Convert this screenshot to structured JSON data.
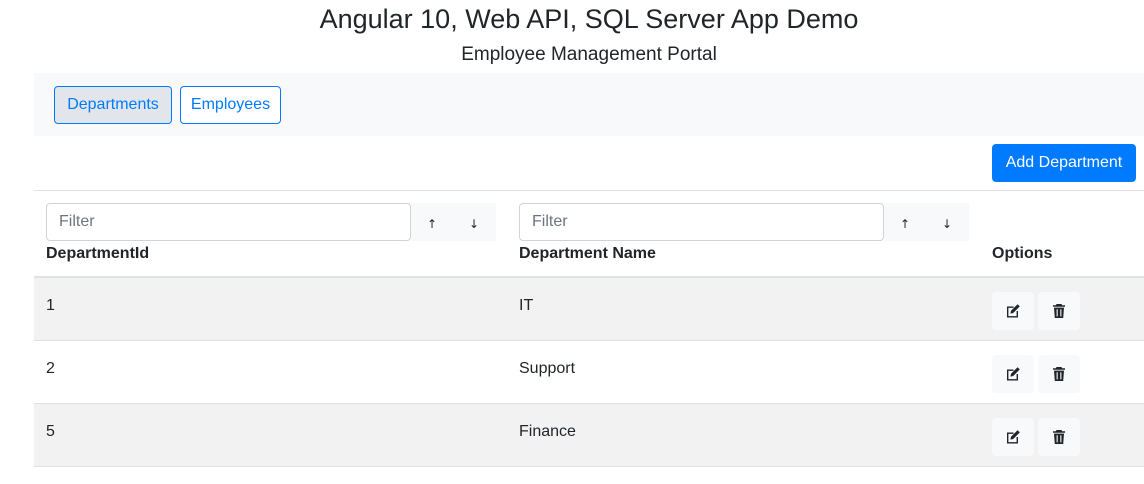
{
  "header": {
    "title": "Angular 10, Web API, SQL Server App Demo",
    "subtitle": "Employee Management Portal"
  },
  "nav": {
    "departments_label": "Departments",
    "employees_label": "Employees",
    "active": "Departments"
  },
  "toolbar": {
    "add_label": "Add Department"
  },
  "filters": {
    "id_placeholder": "Filter",
    "name_placeholder": "Filter",
    "sort_asc_icon": "arrow-up-icon",
    "sort_desc_icon": "arrow-down-icon"
  },
  "table": {
    "columns": [
      "DepartmentId",
      "Department Name",
      "Options"
    ],
    "rows": [
      {
        "id": "1",
        "name": "IT"
      },
      {
        "id": "2",
        "name": "Support"
      },
      {
        "id": "5",
        "name": "Finance"
      }
    ],
    "row_actions": [
      "edit-icon",
      "trash-icon"
    ]
  },
  "colors": {
    "primary": "#007bff",
    "nav_background": "#f8f9fa",
    "striped_row": "#f2f2f2",
    "active_nav_background": "#e2e6ea"
  }
}
